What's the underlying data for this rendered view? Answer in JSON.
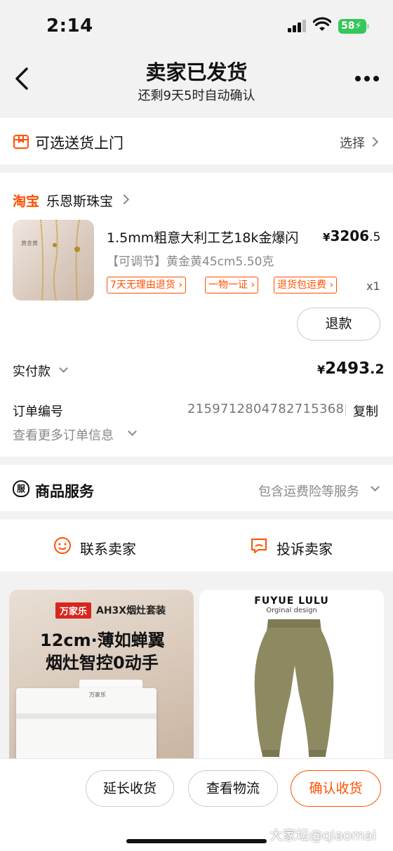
{
  "status_bar": {
    "time": "2:14",
    "battery": "58"
  },
  "header": {
    "title": "卖家已发货",
    "subtitle": "还剩9天5时自动确认"
  },
  "delivery": {
    "label": "可选送货上门",
    "action": "选择"
  },
  "shop": {
    "logo": "淘宝",
    "name": "乐恩斯珠宝"
  },
  "product": {
    "image_label": "黄金黄",
    "title": "1.5mm粗意大利工艺18k金爆闪",
    "price_symbol": "¥",
    "price_int": "3206",
    "price_dec": ".5",
    "spec": "【可调节】黄金黄45cm5.50克",
    "tags": [
      "7天无理由退货",
      "一物一证",
      "退货包运费"
    ],
    "quantity": "x1",
    "refund_label": "退款"
  },
  "payment": {
    "label": "实付款",
    "symbol": "¥",
    "amount_int": "2493",
    "amount_dec": ".2"
  },
  "order": {
    "label": "订单编号",
    "number": "2159712804782715368",
    "copy_label": "复制",
    "more_label": "查看更多订单信息"
  },
  "service": {
    "icon_text": "服",
    "title": "商品服务",
    "detail": "包含运费险等服务"
  },
  "contact": {
    "seller": "联系卖家",
    "complain": "投诉卖家"
  },
  "recommend": [
    {
      "brand": "万家乐",
      "brand_sub": "AH3X烟灶套装",
      "line1": "12cm·薄如蝉翼",
      "line2": "烟灶智控0动手",
      "oven_label": "万家乐"
    },
    {
      "brand": "FUYUE LULU",
      "sub": "Orginal design"
    }
  ],
  "bottom_bar": {
    "extend": "延长收货",
    "logistics": "查看物流",
    "confirm": "确认收货",
    "watermark": "大家坛@qiaomai"
  },
  "colors": {
    "accent": "#ff5000",
    "battery": "#34c759"
  }
}
